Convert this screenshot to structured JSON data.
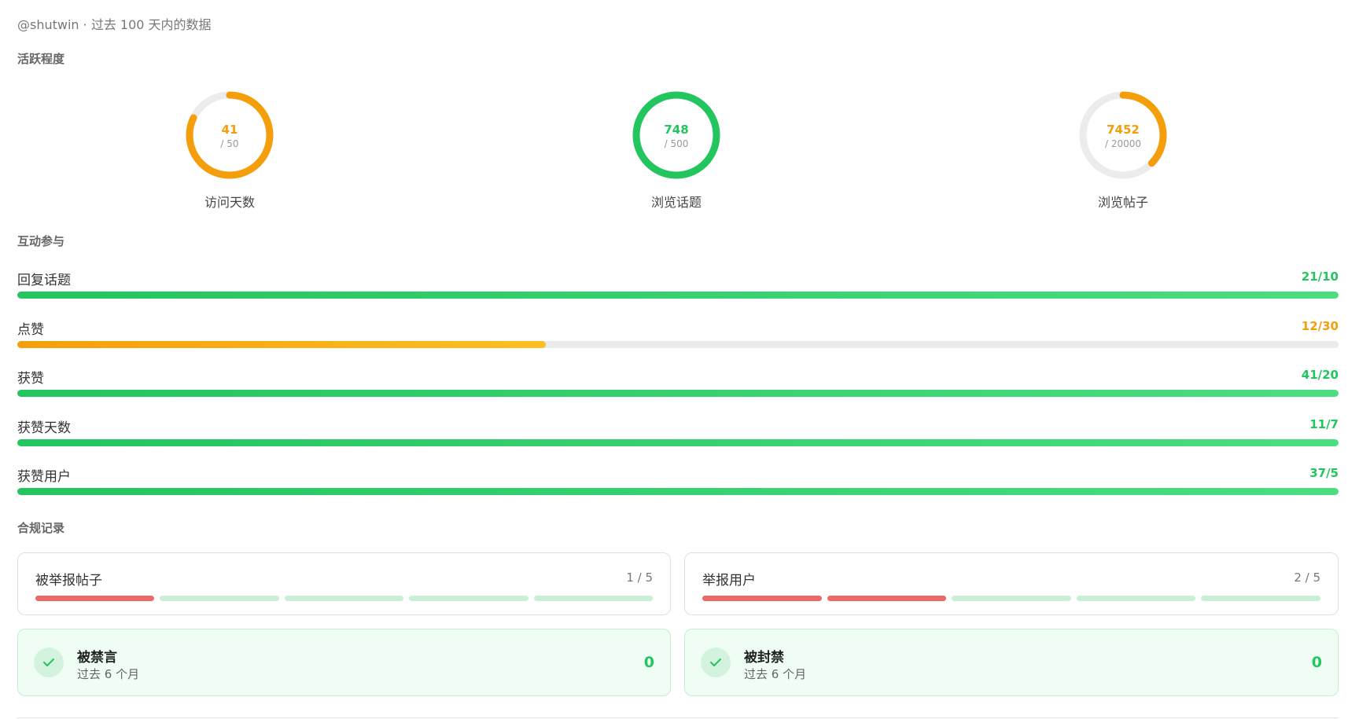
{
  "header": {
    "subtitle": "@shutwin · 过去 100 天内的数据"
  },
  "sections": {
    "activity": "活跃程度",
    "engagement": "互动参与",
    "compliance": "合规记录"
  },
  "rings": [
    {
      "value": 41,
      "max": 50,
      "value_text": "41",
      "max_text": "/ 50",
      "label": "访问天数",
      "color": "#f59e0b"
    },
    {
      "value": 748,
      "max": 500,
      "value_text": "748",
      "max_text": "/ 500",
      "label": "浏览话题",
      "color": "#22c55e"
    },
    {
      "value": 7452,
      "max": 20000,
      "value_text": "7452",
      "max_text": "/ 20000",
      "label": "浏览帖子",
      "color": "#f59e0b"
    }
  ],
  "bars": [
    {
      "label": "回复话题",
      "value": 21,
      "target": 10,
      "count_text": "21/10",
      "color": "#22c55e"
    },
    {
      "label": "点赞",
      "value": 12,
      "target": 30,
      "count_text": "12/30",
      "color": "#f59e0b"
    },
    {
      "label": "获赞",
      "value": 41,
      "target": 20,
      "count_text": "41/20",
      "color": "#22c55e"
    },
    {
      "label": "获赞天数",
      "value": 11,
      "target": 7,
      "count_text": "11/7",
      "color": "#22c55e"
    },
    {
      "label": "获赞用户",
      "value": 37,
      "target": 5,
      "count_text": "37/5",
      "color": "#22c55e"
    }
  ],
  "compliance": {
    "reported_posts": {
      "title": "被举报帖子",
      "count_text": "1 / 5",
      "value": 1,
      "max": 5
    },
    "reported_users": {
      "title": "举报用户",
      "count_text": "2 / 5",
      "value": 2,
      "max": 5
    },
    "silenced": {
      "title": "被禁言",
      "subtitle": "过去 6 个月",
      "value": "0",
      "icon": "check-icon"
    },
    "suspended": {
      "title": "被封禁",
      "subtitle": "过去 6 个月",
      "value": "0",
      "icon": "check-icon"
    }
  }
}
